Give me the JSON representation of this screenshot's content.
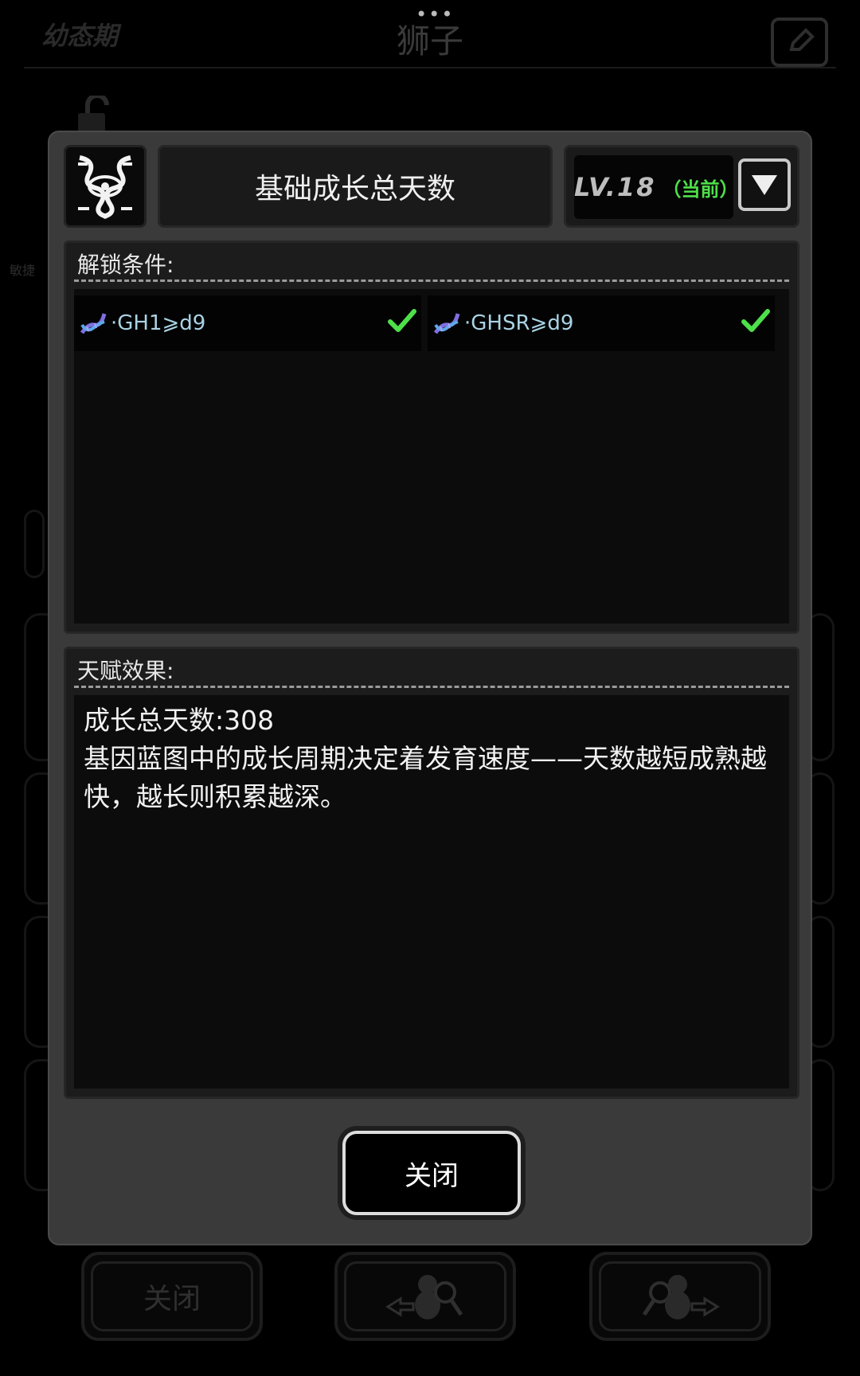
{
  "background": {
    "stage_label": "幼态期",
    "species_title": "狮子",
    "side_label": "敏捷",
    "bottom_buttons": [
      "关闭",
      "",
      ""
    ]
  },
  "dialog": {
    "title": "基础成长总天数",
    "level": "LV.18",
    "level_tag": "（当前）",
    "unlock_section_label": "解锁条件:",
    "unlock_conditions": [
      {
        "text": "·GH1⩾d9",
        "met": true
      },
      {
        "text": "·GHSR⩾d9",
        "met": true
      }
    ],
    "effect_section_label": "天赋效果:",
    "effect_lines": [
      "成长总天数:308",
      "基因蓝图中的成长周期决定着发育速度——天数越短成熟越快，越长则积累越深。"
    ],
    "close_label": "关闭"
  },
  "colors": {
    "check_green": "#4ee04a",
    "condition_text": "#a9d3e4",
    "modal_bg": "#3a3a3a"
  }
}
